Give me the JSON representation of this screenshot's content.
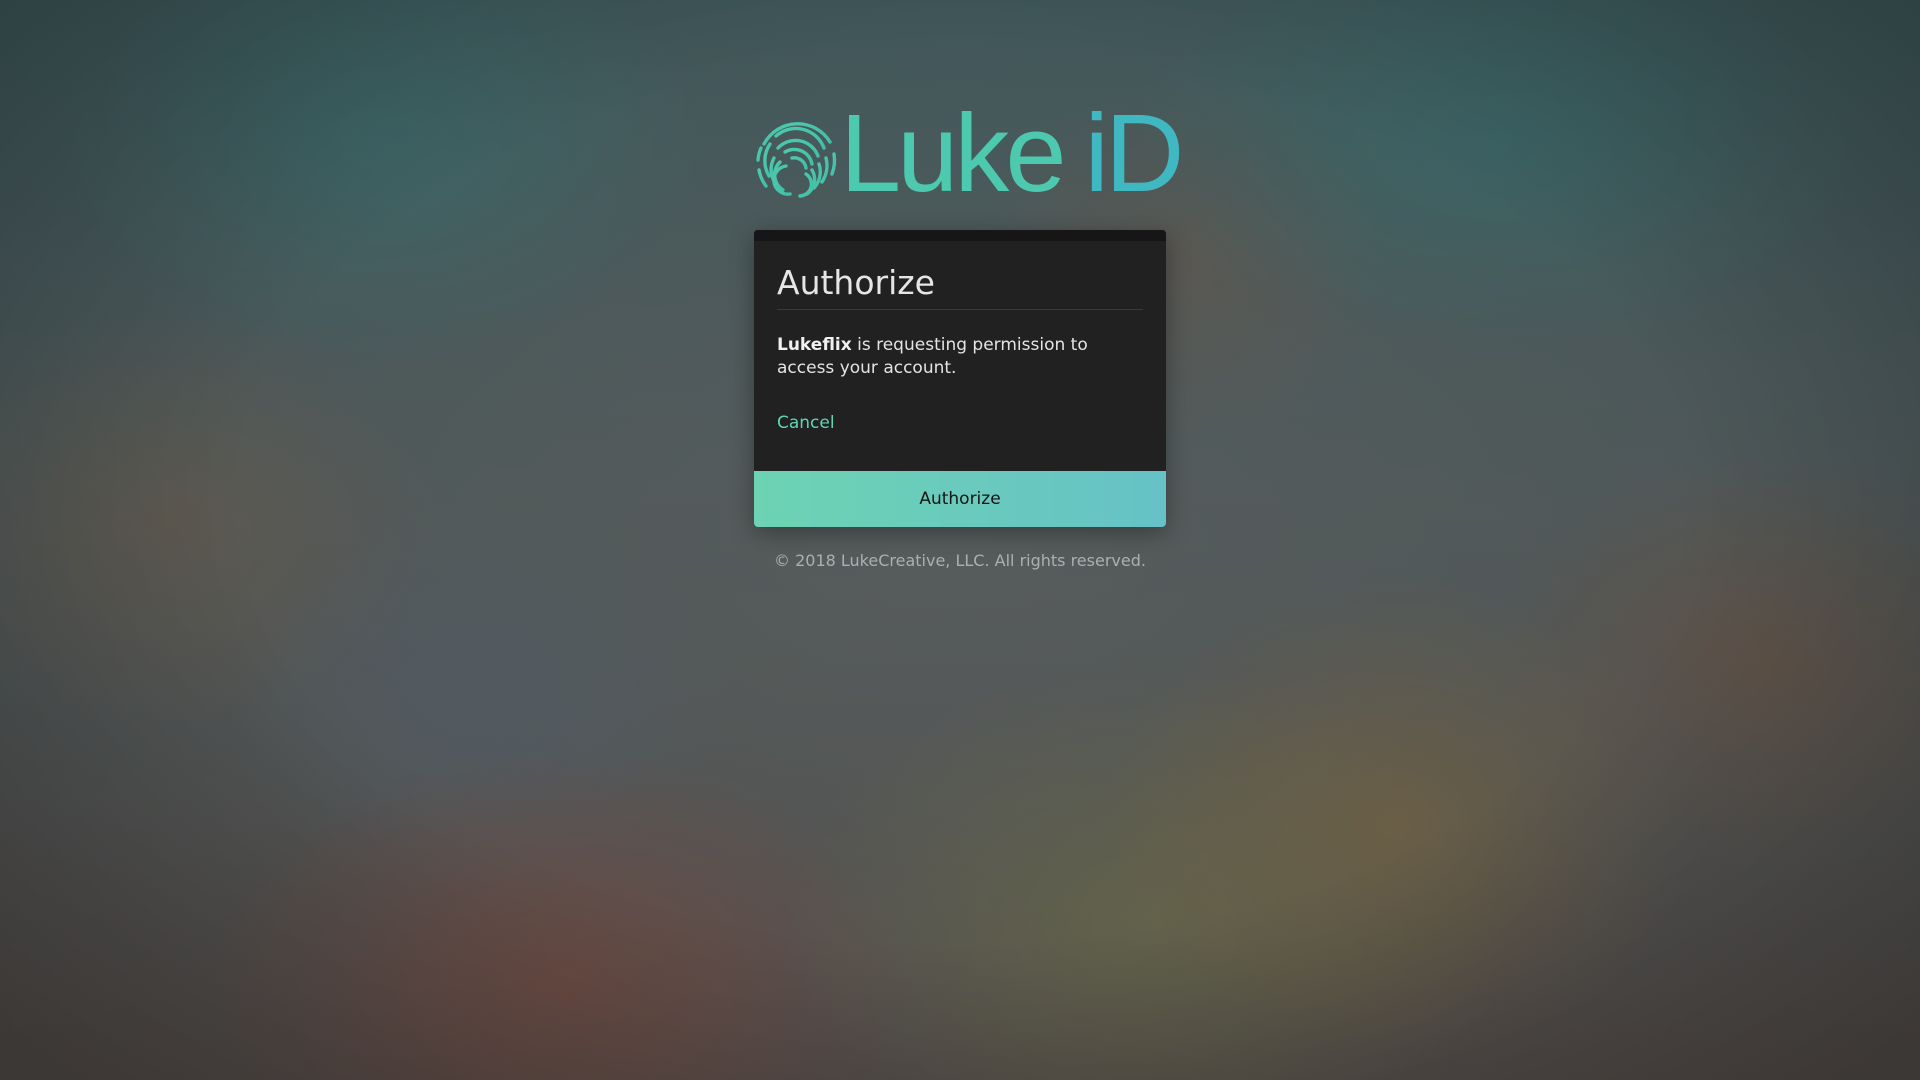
{
  "logo": {
    "word1": "Luke",
    "word2": "iD",
    "icon": "fingerprint-icon",
    "colors": {
      "primary": "#4cc9ae",
      "secondary": "#40b8c2"
    }
  },
  "card": {
    "title": "Authorize",
    "message_app": "Lukeflix",
    "message_rest": " is requesting permission to access your account.",
    "cancel_label": "Cancel",
    "authorize_label": "Authorize"
  },
  "footer": {
    "text": "© 2018 LukeCreative, LLC. All rights reserved."
  },
  "colors": {
    "card_background": "#212121",
    "accent": "#5fd6b4",
    "button_gradient_start": "#6dd3b3",
    "button_gradient_end": "#66c2c6"
  }
}
